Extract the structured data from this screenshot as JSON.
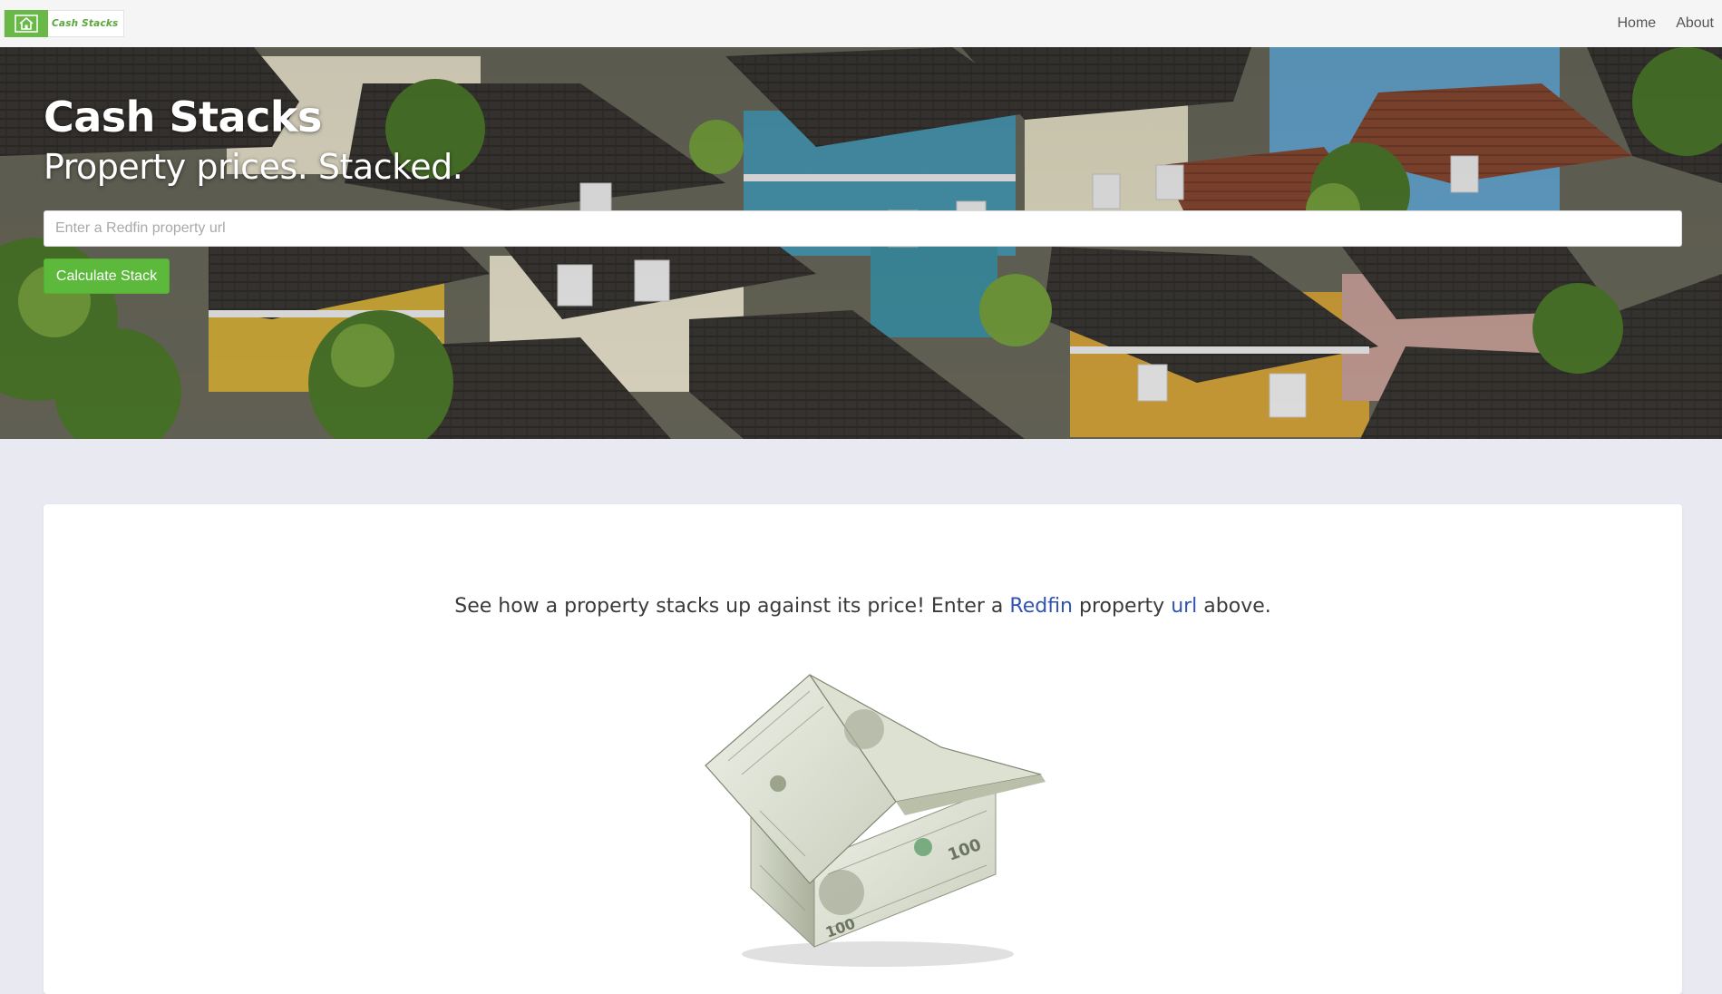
{
  "navbar": {
    "brand_text": "Cash Stacks",
    "brand_icon": "house-icon",
    "links": [
      {
        "label": "Home"
      },
      {
        "label": "About"
      }
    ]
  },
  "hero": {
    "title": "Cash Stacks",
    "subtitle": "Property prices. Stacked.",
    "input_placeholder": "Enter a Redfin property url",
    "input_value": "",
    "button_label": "Calculate Stack"
  },
  "card": {
    "intro_before": "See how a property stacks up against its price! Enter a ",
    "link_redfin": "Redfin",
    "intro_middle": " property ",
    "link_url": "url",
    "intro_after": " above."
  },
  "colors": {
    "accent_green": "#5cb93c",
    "link_blue": "#3154b4",
    "page_background": "#e9e9f2"
  }
}
